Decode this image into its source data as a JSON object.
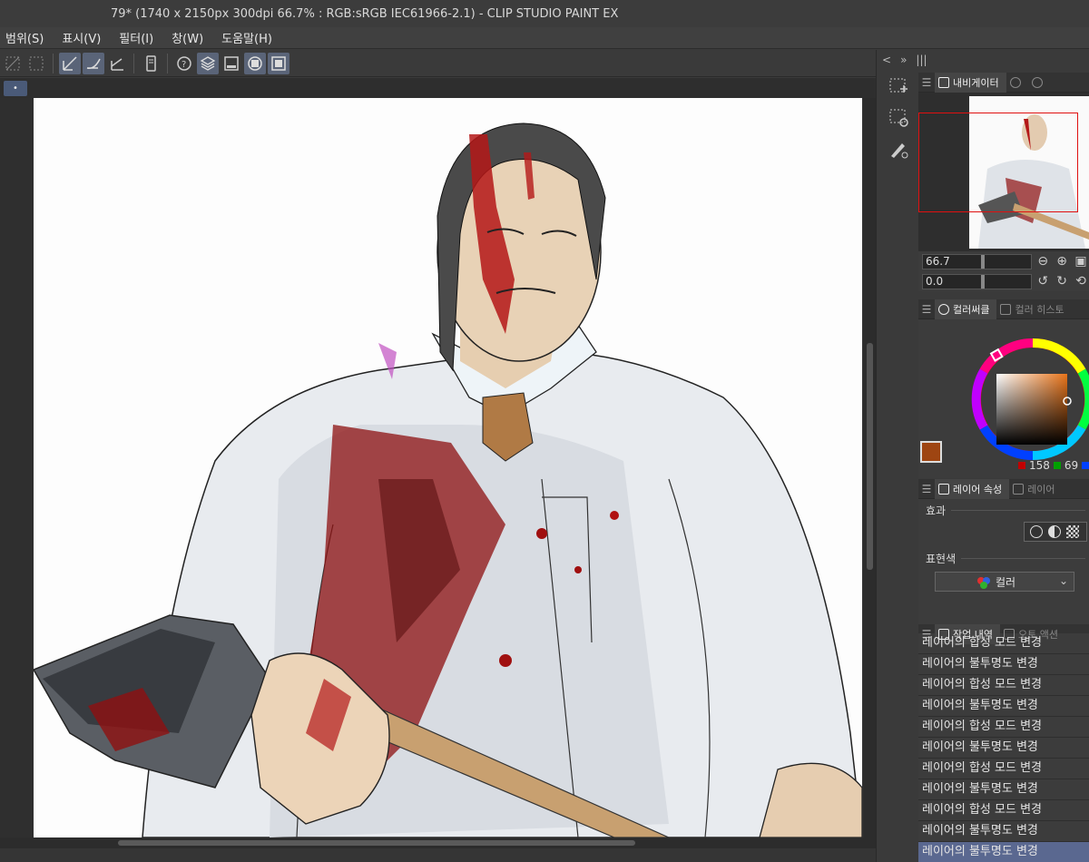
{
  "window": {
    "title": "79* (1740 x 2150px 300dpi 66.7% : RGB:sRGB IEC61966-2.1)  - CLIP STUDIO PAINT EX"
  },
  "menu": [
    "범위(S)",
    "표시(V)",
    "필터(I)",
    "창(W)",
    "도움말(H)"
  ],
  "toolbar": {
    "buttons": [
      {
        "icon": "snap-grid-icon",
        "active": false
      },
      {
        "icon": "snap-special-ruler-icon",
        "active": false
      },
      {
        "icon": "ruler-line-icon",
        "active": true
      },
      {
        "icon": "ruler-curve-icon",
        "active": true
      },
      {
        "icon": "ruler-perspective-icon",
        "active": false
      },
      {
        "icon": "device-icon",
        "active": false
      },
      {
        "icon": "help-icon",
        "active": false
      },
      {
        "icon": "layer-icon",
        "active": true
      },
      {
        "icon": "image-icon",
        "active": false
      },
      {
        "icon": "circle-display-icon",
        "active": true
      },
      {
        "icon": "square-display-icon",
        "active": true
      }
    ]
  },
  "canvas_tab": {
    "indicator": "•"
  },
  "command_bar": {
    "collapse": "<",
    "expand": "»",
    "grip": "|||"
  },
  "navigator": {
    "tab_label": "내비게이터",
    "zoom_value": "66.7",
    "rotate_value": "0.0"
  },
  "color_panel": {
    "tab_label": "컬러써클",
    "tab2_label": "컬러 히스토",
    "main_color": "#9e4512",
    "sub_color": "#ffffff",
    "rgb": {
      "r": "158",
      "g": "69"
    }
  },
  "layer_property": {
    "tab_label": "레이어 속성",
    "tab2_label": "레이어",
    "effect_label": "효과",
    "expression_label": "표현색",
    "expression_value": "컬러"
  },
  "history": {
    "tab_label": "작업 내역",
    "tab2_label": "오토 액션",
    "items": [
      "레이어의 합성 모드 변경",
      "레이어의 불투명도 변경",
      "레이어의 합성 모드 변경",
      "레이어의 불투명도 변경",
      "레이어의 합성 모드 변경",
      "레이어의 불투명도 변경",
      "레이어의 합성 모드 변경",
      "레이어의 불투명도 변경",
      "레이어의 합성 모드 변경",
      "레이어의 불투명도 변경",
      "레이어의 불투명도 변경"
    ],
    "selected_index": 10
  }
}
